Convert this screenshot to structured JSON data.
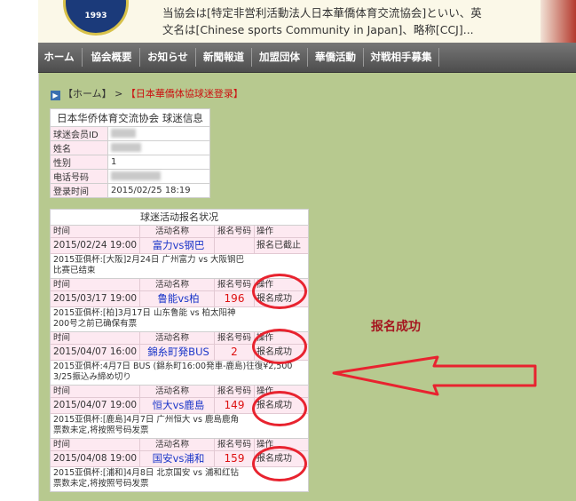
{
  "header": {
    "logo_year": "1993",
    "line1": "当協会は[特定非営利活動法人日本華僑体育交流協会]といい、英",
    "line2": "文名は[Chinese sports Community in Japan]、略称[CCJ]..."
  },
  "nav": [
    {
      "label": "ホーム"
    },
    {
      "label": "協会概要"
    },
    {
      "label": "お知らせ"
    },
    {
      "label": "新聞報道"
    },
    {
      "label": "加盟団体"
    },
    {
      "label": "華僑活動"
    },
    {
      "label": "対戦相手募集"
    }
  ],
  "breadcrumb": {
    "home": "【ホーム】",
    "sep": ">",
    "current": "【日本華僑体協球迷登录】"
  },
  "member": {
    "title": "日本华侨体育交流协会 球迷信息",
    "rows": [
      {
        "label": "球迷会员ID",
        "value": ""
      },
      {
        "label": "姓名",
        "value": ""
      },
      {
        "label": "性别",
        "value": "1"
      },
      {
        "label": "电话号码",
        "value": ""
      },
      {
        "label": "登录时间",
        "value": "2015/02/25 18:19"
      }
    ]
  },
  "registration": {
    "title": "球迷活动报名状况",
    "headers": {
      "time": "时间",
      "name": "活动名称",
      "number": "报名号码",
      "op": "操作"
    },
    "events": [
      {
        "time": "2015/02/24 19:00",
        "name": "富力vs钢巴",
        "number": "",
        "status": "报名已截止",
        "note1": "2015亚俱杯:[大阪]2月24日 广州富力 vs 大阪钢巴",
        "note2": "比赛已结束"
      },
      {
        "time": "2015/03/17 19:00",
        "name": "鲁能vs柏",
        "number": "196",
        "status": "报名成功",
        "note1": "2015亚俱杯:[柏]3月17日 山东鲁能 vs 柏太阳神",
        "note2": "200号之前已确保有票"
      },
      {
        "time": "2015/04/07 16:00",
        "name": "錦糸町発BUS",
        "number": "2",
        "status": "报名成功",
        "note1": "2015亚俱杯:4月7日 BUS (錦糸町16:00発車-鹿島)往復¥2,500",
        "note2": "3/25振込み締め切り"
      },
      {
        "time": "2015/04/07 19:00",
        "name": "恒大vs鹿島",
        "number": "149",
        "status": "报名成功",
        "note1": "2015亚俱杯:[鹿島]4月7日 广州恒大 vs 鹿島鹿角",
        "note2": "票数未定,将按照号码发票"
      },
      {
        "time": "2015/04/08 19:00",
        "name": "国安vs浦和",
        "number": "159",
        "status": "报名成功",
        "note1": "2015亚俱杯:[浦和]4月8日 北京国安 vs 浦和红钻",
        "note2": "票数未定,将按照号码发票"
      }
    ]
  },
  "annotation": {
    "label": "报名成功",
    "color": "#e8232f"
  }
}
